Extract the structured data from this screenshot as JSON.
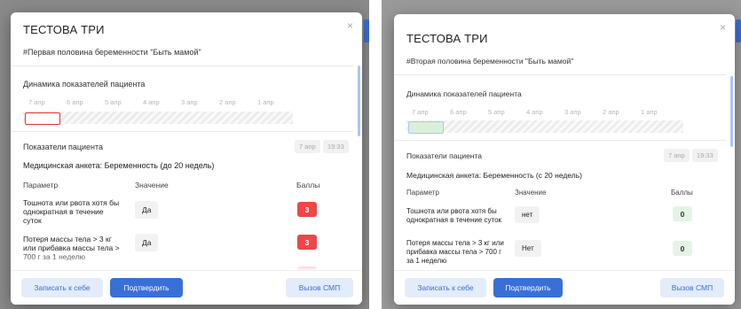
{
  "left": {
    "title": "ТЕСТОВА ТРИ",
    "close": "×",
    "program": "#Первая половина беременности \"Быть мамой\"",
    "dynamics_title": "Динамика показателей пациента",
    "dates": [
      "7 апр",
      "6 апр",
      "5 апр",
      "4 апр",
      "3 апр",
      "2 апр",
      "1 апр"
    ],
    "indicators_title": "Показатели пациента",
    "pill_date": "7 апр",
    "pill_time": "19:33",
    "anketa": "Медицинская анкета: Беременность (до 20 недель)",
    "col_param": "Параметр",
    "col_value": "Значение",
    "col_score": "Баллы",
    "rows": [
      {
        "param": "Тошнота или рвота хотя бы однократная в течение суток",
        "value": "Да",
        "score": "3"
      },
      {
        "param": "Потеря массы тела > 3 кг или прибавка массы тела > 700 г за 1 неделю",
        "value": "Да",
        "score": "3"
      }
    ],
    "btn_record": "Записать к себе",
    "btn_confirm": "Подтвердить",
    "btn_smp": "Вызов СМП",
    "accent_red": "#ee4747"
  },
  "right": {
    "title": "ТЕСТОВА ТРИ",
    "close": "×",
    "program": "#Вторая половина беременности \"Быть мамой\"",
    "dynamics_title": "Динамика показателей пациента",
    "dates": [
      "7 апр",
      "6 апр",
      "5 апр",
      "4 апр",
      "3 апр",
      "2 апр",
      "1 апр"
    ],
    "indicators_title": "Показатели пациента",
    "pill_date": "7 апр",
    "pill_time": "19:33",
    "anketa": "Медицинская анкета: Беременность (с 20 недель)",
    "col_param": "Параметр",
    "col_value": "Значение",
    "col_score": "Баллы",
    "rows": [
      {
        "param": "Тошнота или рвота хотя бы однократная в течение суток",
        "value": "нет",
        "score": "0"
      },
      {
        "param": "Потеря массы тела > 3 кг или прибавка массы тела > 700 г за 1 неделю",
        "value": "Нет",
        "score": "0"
      }
    ],
    "btn_record": "Записать к себе",
    "btn_confirm": "Подтвердить",
    "btn_smp": "Вызов СМП",
    "accent_green": "#e4f4e4"
  }
}
